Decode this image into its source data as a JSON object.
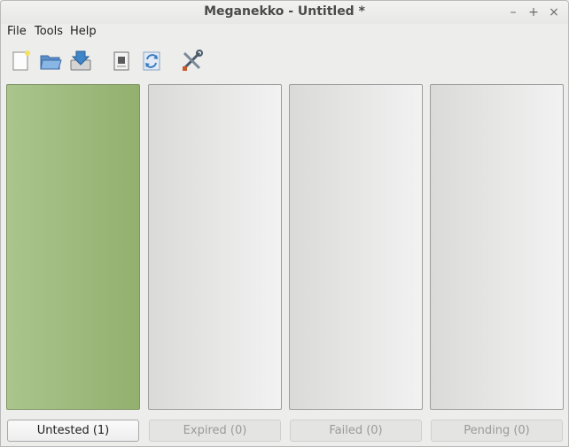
{
  "window": {
    "title": "Meganekko - Untitled *",
    "controls": {
      "minimize": "–",
      "maximize": "+",
      "close": "×"
    }
  },
  "menubar": {
    "items": [
      "File",
      "Tools",
      "Help"
    ]
  },
  "toolbar": {
    "icons": [
      "new-file-icon",
      "open-folder-icon",
      "import-icon",
      "document-icon",
      "refresh-icon",
      "settings-tools-icon"
    ]
  },
  "panels": [
    {
      "label": "Untested (1)",
      "active": true
    },
    {
      "label": "Expired (0)",
      "active": false
    },
    {
      "label": "Failed (0)",
      "active": false
    },
    {
      "label": "Pending (0)",
      "active": false
    }
  ],
  "colors": {
    "active_panel": "#9dba7c",
    "idle_panel": "#e6e6e6",
    "window_bg": "#ededec"
  }
}
